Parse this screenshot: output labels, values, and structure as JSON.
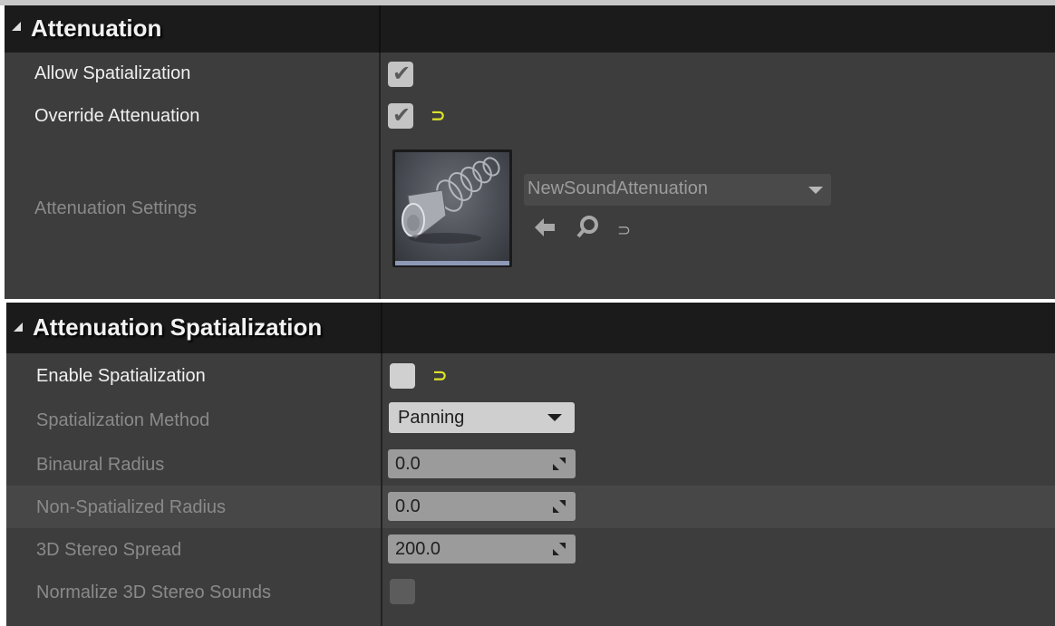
{
  "attenuation": {
    "title": "Attenuation",
    "allow_spatialization": {
      "label": "Allow Spatialization",
      "checked": true
    },
    "override_attenuation": {
      "label": "Override Attenuation",
      "checked": true
    },
    "attenuation_settings": {
      "label": "Attenuation Settings",
      "asset_name": "NewSoundAttenuation"
    }
  },
  "spatialization": {
    "title": "Attenuation Spatialization",
    "enable_spatialization": {
      "label": "Enable Spatialization",
      "checked": false
    },
    "method": {
      "label": "Spatialization Method",
      "value": "Panning"
    },
    "binaural_radius": {
      "label": "Binaural Radius",
      "value": "0.0"
    },
    "non_spatialized_radius": {
      "label": "Non-Spatialized Radius",
      "value": "0.0"
    },
    "stereo_spread": {
      "label": "3D Stereo Spread",
      "value": "200.0"
    },
    "normalize_stereo": {
      "label": "Normalize 3D Stereo Sounds",
      "checked": false
    }
  },
  "icons": {
    "check": "✔",
    "reset": "⊃",
    "back": "🡄",
    "browse": "⚲",
    "reset_default": "⊃"
  },
  "colors": {
    "panel_bg": "#3d3d3d",
    "header_bg": "#1b1b1b",
    "reset_yellow": "#dde32a"
  }
}
